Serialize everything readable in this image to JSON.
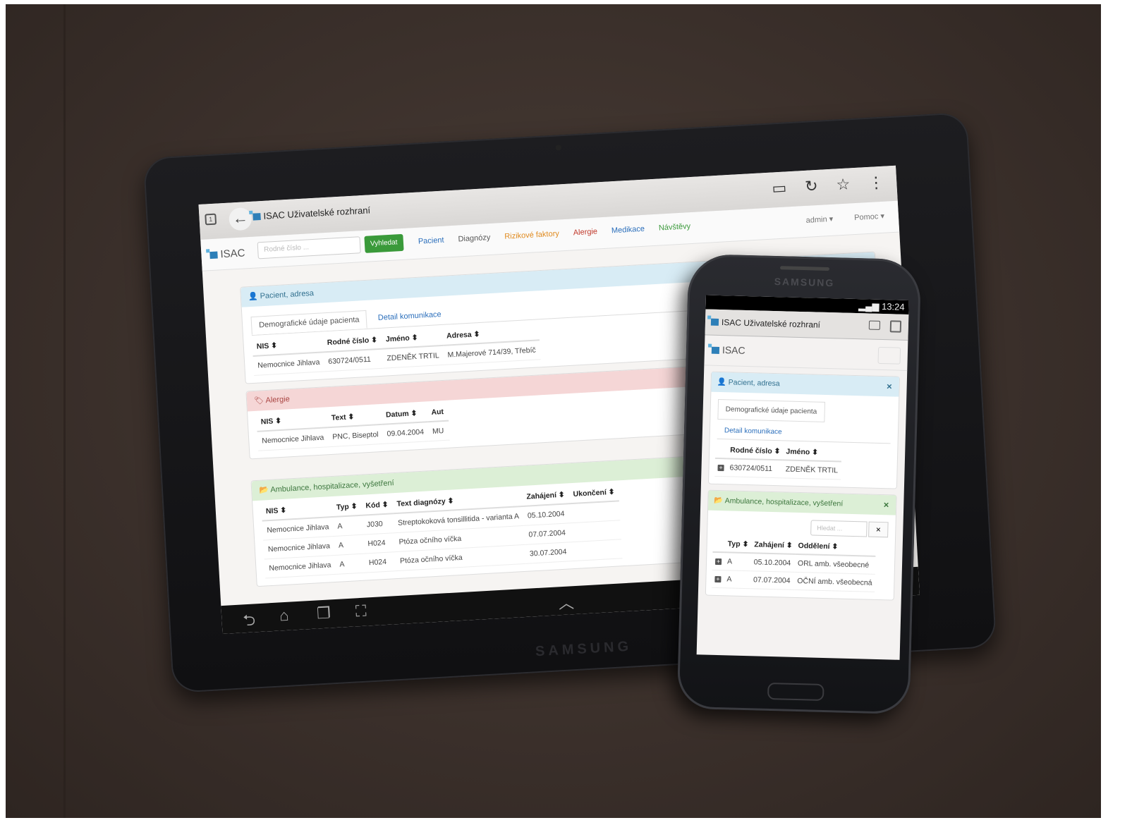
{
  "tablet": {
    "device_brand": "SAMSUNG",
    "browser_tab_title": "ISAC Uživatelské rozhraní",
    "app_brand": "ISAC",
    "search_placeholder": "Rodné číslo ...",
    "search_button": "Vyhledat",
    "nav": [
      {
        "label": "Pacient",
        "color": "#2a6ebb"
      },
      {
        "label": "Diagnózy",
        "color": "#555555"
      },
      {
        "label": "Rizikové faktory",
        "color": "#e08a1e"
      },
      {
        "label": "Alergie",
        "color": "#c0392b"
      },
      {
        "label": "Medikace",
        "color": "#2a6ebb"
      },
      {
        "label": "Návštěvy",
        "color": "#3c9a3c"
      }
    ],
    "admin": "admin ▾",
    "help": "Pomoc ▾",
    "patient_panel": {
      "title": "Pacient, adresa",
      "tab_active": "Demografické údaje pacienta",
      "tab_other": "Detail komunikace",
      "headers": [
        "NIS ⬍",
        "Rodné číslo ⬍",
        "Jméno ⬍",
        "Adresa ⬍"
      ],
      "rows": [
        [
          "Nemocnice Jihlava",
          "630724/0511",
          "ZDENĚK TRTIL",
          "M.Majerové 714/39, Třebíč"
        ]
      ]
    },
    "allergy_panel": {
      "title": "Alergie",
      "headers": [
        "NIS ⬍",
        "Text ⬍",
        "Datum ⬍",
        "Aut"
      ],
      "rows": [
        [
          "Nemocnice Jihlava",
          "PNC, Biseptol",
          "09.04.2004",
          "MU"
        ]
      ]
    },
    "visits_panel": {
      "title": "Ambulance, hospitalizace, vyšetření",
      "headers": [
        "NIS ⬍",
        "Typ ⬍",
        "Kód ⬍",
        "Text diagnózy ⬍",
        "Zahájení ⬍",
        "Ukončení ⬍"
      ],
      "rows": [
        [
          "Nemocnice Jihlava",
          "A",
          "J030",
          "Streptokoková tonsillitida - varianta A",
          "05.10.2004",
          ""
        ],
        [
          "Nemocnice Jihlava",
          "A",
          "H024",
          "Ptóza očního víčka",
          "07.07.2004",
          ""
        ],
        [
          "Nemocnice Jihlava",
          "A",
          "H024",
          "Ptóza očního víčka",
          "30.07.2004",
          ""
        ]
      ]
    }
  },
  "phone": {
    "device_brand": "SAMSUNG",
    "status_time": "13:24",
    "browser_tab_title": "ISAC Uživatelské rozhraní",
    "app_brand": "ISAC",
    "patient_panel": {
      "title": "Pacient, adresa",
      "close": "×",
      "tab_active": "Demografické údaje pacienta",
      "tab_other": "Detail komunikace",
      "headers": [
        "",
        "Rodné číslo ⬍",
        "Jméno ⬍"
      ],
      "rows": [
        [
          "+",
          "630724/0511",
          "ZDENĚK TRTIL"
        ]
      ]
    },
    "visits_panel": {
      "title": "Ambulance, hospitalizace, vyšetření",
      "close": "×",
      "search_placeholder": "Hledat ...",
      "search_clear": "×",
      "headers": [
        "",
        "Typ ⬍",
        "Zahájení ⬍",
        "Oddělení ⬍"
      ],
      "rows": [
        [
          "+",
          "A",
          "05.10.2004",
          "ORL amb. všeobecné"
        ],
        [
          "+",
          "A",
          "07.07.2004",
          "OČNÍ amb. všeobecná"
        ]
      ]
    }
  }
}
